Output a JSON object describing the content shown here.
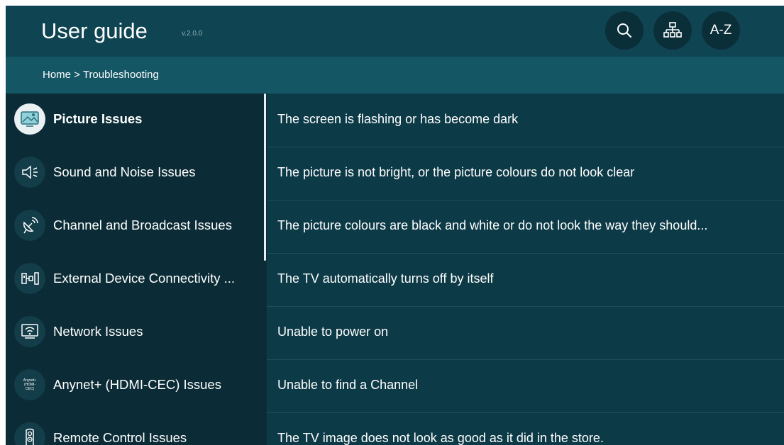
{
  "header": {
    "title": "User guide",
    "version": "v.2.0.0",
    "az_label": "A-Z",
    "search_icon": "search-icon",
    "sitemap_icon": "sitemap-icon"
  },
  "breadcrumb": "Home > Troubleshooting",
  "sidebar": {
    "items": [
      {
        "label": "Picture Issues",
        "icon": "picture-icon",
        "active": true
      },
      {
        "label": "Sound and Noise Issues",
        "icon": "speaker-icon"
      },
      {
        "label": "Channel and Broadcast Issues",
        "icon": "satellite-dish-icon"
      },
      {
        "label": "External Device Connectivity ...",
        "icon": "external-device-icon"
      },
      {
        "label": "Network Issues",
        "icon": "wifi-tv-icon"
      },
      {
        "label": "Anynet+ (HDMI-CEC) Issues",
        "icon": "anynet-icon",
        "icon_text": "Anynet+ (HDMI-CEC)"
      },
      {
        "label": "Remote Control Issues",
        "icon": "remote-control-icon"
      }
    ]
  },
  "topics": [
    "The screen is flashing or has become dark",
    "The picture is not bright, or the picture colours do not look clear",
    "The picture colours are black and white or do not look the way they should...",
    "The TV automatically turns off by itself",
    "Unable to power on",
    "Unable to find a Channel",
    "The TV image does not look as good as it did in the store."
  ],
  "colors": {
    "background": "#0d3a47",
    "header": "#0f4552",
    "breadcrumb_bar": "#155665",
    "sidebar": "#0b2c36",
    "active_icon_bg": "#e9f1f3"
  }
}
